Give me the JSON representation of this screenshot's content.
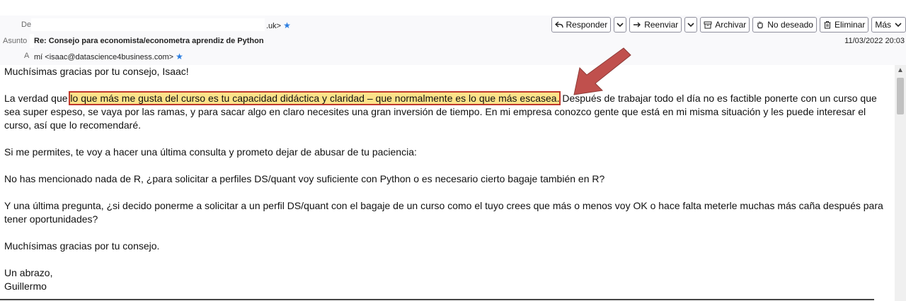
{
  "header": {
    "from_label": "De",
    "from_suffix": ".uk>",
    "subject_label": "Asunto",
    "subject": "Re: Consejo para economista/econometra aprendiz de Python",
    "to_label": "A",
    "to": "mí <isaac@datascience4business.com>",
    "date": "11/03/2022 20:03"
  },
  "toolbar": {
    "reply": "Responder",
    "forward": "Reenviar",
    "archive": "Archivar",
    "junk": "No deseado",
    "delete": "Eliminar",
    "more": "Más"
  },
  "message": {
    "p1": "Muchísimas gracias por tu consejo, Isaac!",
    "p2_before": "La verdad que ",
    "p2_highlight": "lo que más me gusta del curso es tu capacidad didáctica y claridad – que normalmente es lo que más escasea.",
    "p2_after": " Después de trabajar todo el día no es factible ponerte con un curso que sea super espeso, se vaya por las ramas, y para sacar algo en claro necesites una gran inversión de tiempo. En mi empresa conozco gente que está en mi misma situación y les puede interesar el curso, así que lo recomendaré.",
    "p3": "Si me permites, te voy a hacer una última consulta y prometo dejar de abusar de tu paciencia:",
    "p4": "No has mencionado nada de R, ¿para solicitar a perfiles DS/quant voy suficiente con Python o es necesario cierto bagaje también en R?",
    "p5": "Y una última pregunta, ¿si decido ponerme a solicitar a un perfil DS/quant con el bagaje de un curso como el tuyo crees que más o menos voy OK o hace falta meterle muchas más caña después para tener oportunidades?",
    "p6": "Muchísimas gracias por tu consejo.",
    "sign1": "Un abrazo,",
    "sign2": "Guillermo"
  },
  "colors": {
    "highlight_fill": "#fde38a",
    "highlight_border": "#c0392b",
    "arrow": "#c0504d",
    "star": "#2a7de1"
  }
}
